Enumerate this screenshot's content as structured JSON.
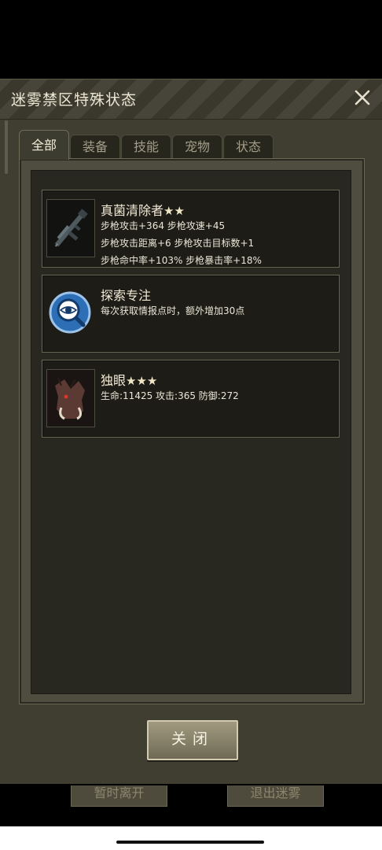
{
  "dialog": {
    "title": "迷雾禁区特殊状态"
  },
  "tabs": [
    {
      "label": "全部",
      "active": true
    },
    {
      "label": "装备",
      "active": false
    },
    {
      "label": "技能",
      "active": false
    },
    {
      "label": "宠物",
      "active": false
    },
    {
      "label": "状态",
      "active": false
    }
  ],
  "items": [
    {
      "name": "真菌清除者",
      "stars": "★★",
      "icon": "rifle-icon",
      "lines": [
        "步枪攻击+364  步枪攻速+45",
        "步枪攻击距离+6  步枪攻击目标数+1",
        "步枪命中率+103%  步枪暴击率+18%"
      ]
    },
    {
      "name": "探索专注",
      "icon": "magnifier-eye-icon",
      "lines": [
        "每次获取情报点时，额外增加30点"
      ]
    },
    {
      "name": "独眼",
      "stars": "★★★",
      "icon": "boar-pet-icon",
      "lines": [
        "生命:11425  攻击:365  防御:272"
      ]
    }
  ],
  "buttons": {
    "close": "关闭"
  },
  "background_buttons": {
    "left": "暂时离开",
    "right": "退出迷雾"
  }
}
